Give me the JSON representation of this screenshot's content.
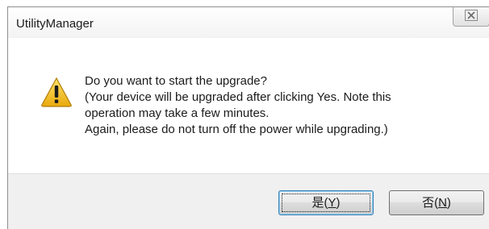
{
  "window": {
    "title": "UtilityManager",
    "close_glyph": "☒"
  },
  "message": {
    "icon": "warning-triangle-icon",
    "lines": [
      "Do you want to start the upgrade?",
      "(Your device will be upgraded after clicking Yes. Note this",
      "operation may take a few minutes.",
      "Again, please do not turn off the power while upgrading.)"
    ]
  },
  "buttons": {
    "yes": {
      "label": "是(",
      "mnemonic": "Y",
      "suffix": ")"
    },
    "no": {
      "label": "否(",
      "mnemonic": "N",
      "suffix": ")"
    }
  },
  "colors": {
    "warning_fill": "#f4c31a",
    "footer_bg": "#f0f0f0"
  }
}
